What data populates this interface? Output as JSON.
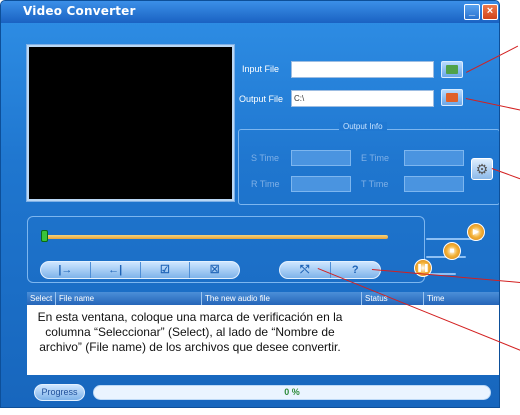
{
  "window": {
    "title": "Video Converter",
    "minimize_glyph": "_",
    "close_glyph": "×"
  },
  "input": {
    "label": "Input File",
    "value": ""
  },
  "output": {
    "label": "Output File",
    "value": "C:\\"
  },
  "output_info": {
    "title": "Output Info",
    "s_time_label": "S Time",
    "e_time_label": "E Time",
    "r_time_label": "R Time",
    "t_time_label": "T Time"
  },
  "controls": {
    "nav_buttons": [
      "|→",
      "←|",
      "☑",
      "☒"
    ],
    "tool_buttons": [
      "⤲",
      "?"
    ]
  },
  "file_list": {
    "columns": [
      "Select",
      "File name",
      "The new audio file",
      "Status",
      "Time"
    ]
  },
  "caption": "En esta ventana, coloque una marca de verificación en la columna “Seleccionar” (Select), al lado de “Nombre de archivo” (File name) de los archivos que desee convertir.",
  "progress": {
    "button_label": "Progress",
    "percent_text": "0 %",
    "value": 0
  },
  "colors": {
    "window_bg": "#1f76cf",
    "accent_orange": "#f0a030",
    "callout_red": "#d32020"
  }
}
